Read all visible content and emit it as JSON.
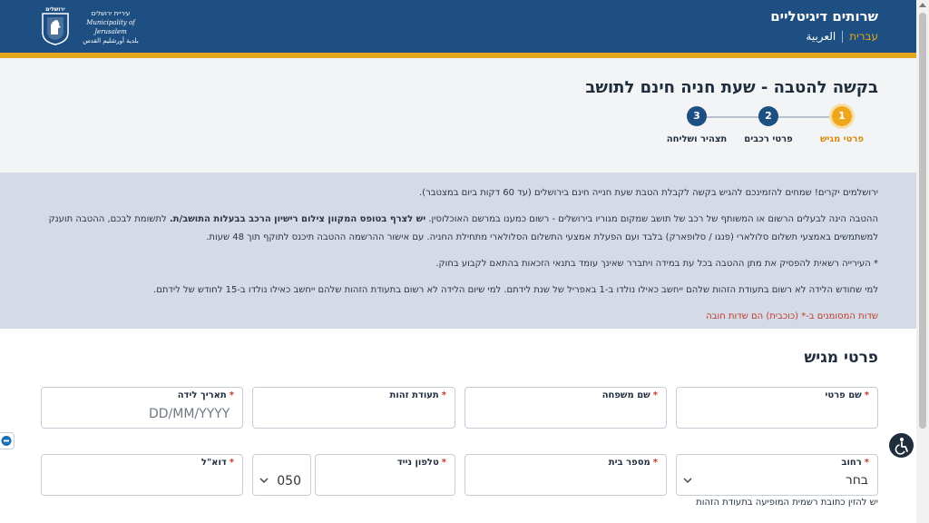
{
  "header": {
    "brand_title": "שרותים דיגיטליים",
    "lang_active": "עברית",
    "lang_other": "العربية",
    "logo_line1": "עיריית ירושלים",
    "logo_line2": "Municipality of Jerusalem",
    "logo_line3": "بلدية أورشليم القدس",
    "logo_wordmark": "ירושלים"
  },
  "title_panel": {
    "title": "בקשה להטבה - שעת חניה חינם לתושב",
    "steps": [
      {
        "number": "1",
        "label": "פרטי מגיש"
      },
      {
        "number": "2",
        "label": "פרטי רכבים"
      },
      {
        "number": "3",
        "label": "תצהיר ושליחה"
      }
    ]
  },
  "info": {
    "p1": "ירושלמים יקרים! שמחים להזמינכם להגיש בקשה לקבלת הטבת שעת חנייה חינם בירושלים (עד 60 דקות ביום במצטבר).",
    "p2a": "ההטבה הינה לבעלים הרשום או המשותף של רכב של תושב שמקום מגוריו בירושלים - רשום כמענו במרשם האוכלוסין. ",
    "p2b": "יש לצרף בטופס המקוון צילום רישיון הרכב בבעלות התושב/ת.",
    "p2c": " לתשומת לבכם, ההטבה תוענק למשתמשים באמצעי תשלום סלולארי (פנגו / סלופארק) בלבד ועם הפעלת אמצעי התשלום הסלולארי מתחילת החניה. עם אישור ההרשמה ההטבה תיכנס לתוקף תוך 48 שעות.",
    "p3": "* העירייה רשאית להפסיק את מתן ההטבה בכל עת במידה ויתברר שאינך עומד בתנאי הזכאות בהתאם לקבוע בחוק.",
    "p4": "למי שחודש הלידה לא רשום בתעודת הזהות שלהם ייחשב כאילו נולדו ב-1 באפריל של שנת לידתם. למי שיום הלידה לא רשום בתעודת הזהות שלהם ייחשב כאילו נולדו ב-15 לחודש של לידתם.",
    "required_note": "שדות המסומנים ב-* (כוכבית) הם שדות חובה"
  },
  "form": {
    "section_title": "פרטי מגיש",
    "first_name_label": "שם פרטי",
    "last_name_label": "שם משפחה",
    "id_label": "תעודת זהות",
    "birth_label": "תאריך לידה",
    "birth_placeholder": "DD/MM/YYYY",
    "street_label": "רחוב",
    "street_value": "בחר",
    "house_label": "מספר בית",
    "phone_label": "טלפון נייד",
    "prefix_value": "050",
    "email_label": "דוא\"ל",
    "hint": "יש להזין כתובת רשמית המופיעה בתעודת הזהות"
  },
  "colors": {
    "header_blue": "#1e4f82",
    "accent_gold": "#e3a81b",
    "required_red": "#c0392b"
  }
}
